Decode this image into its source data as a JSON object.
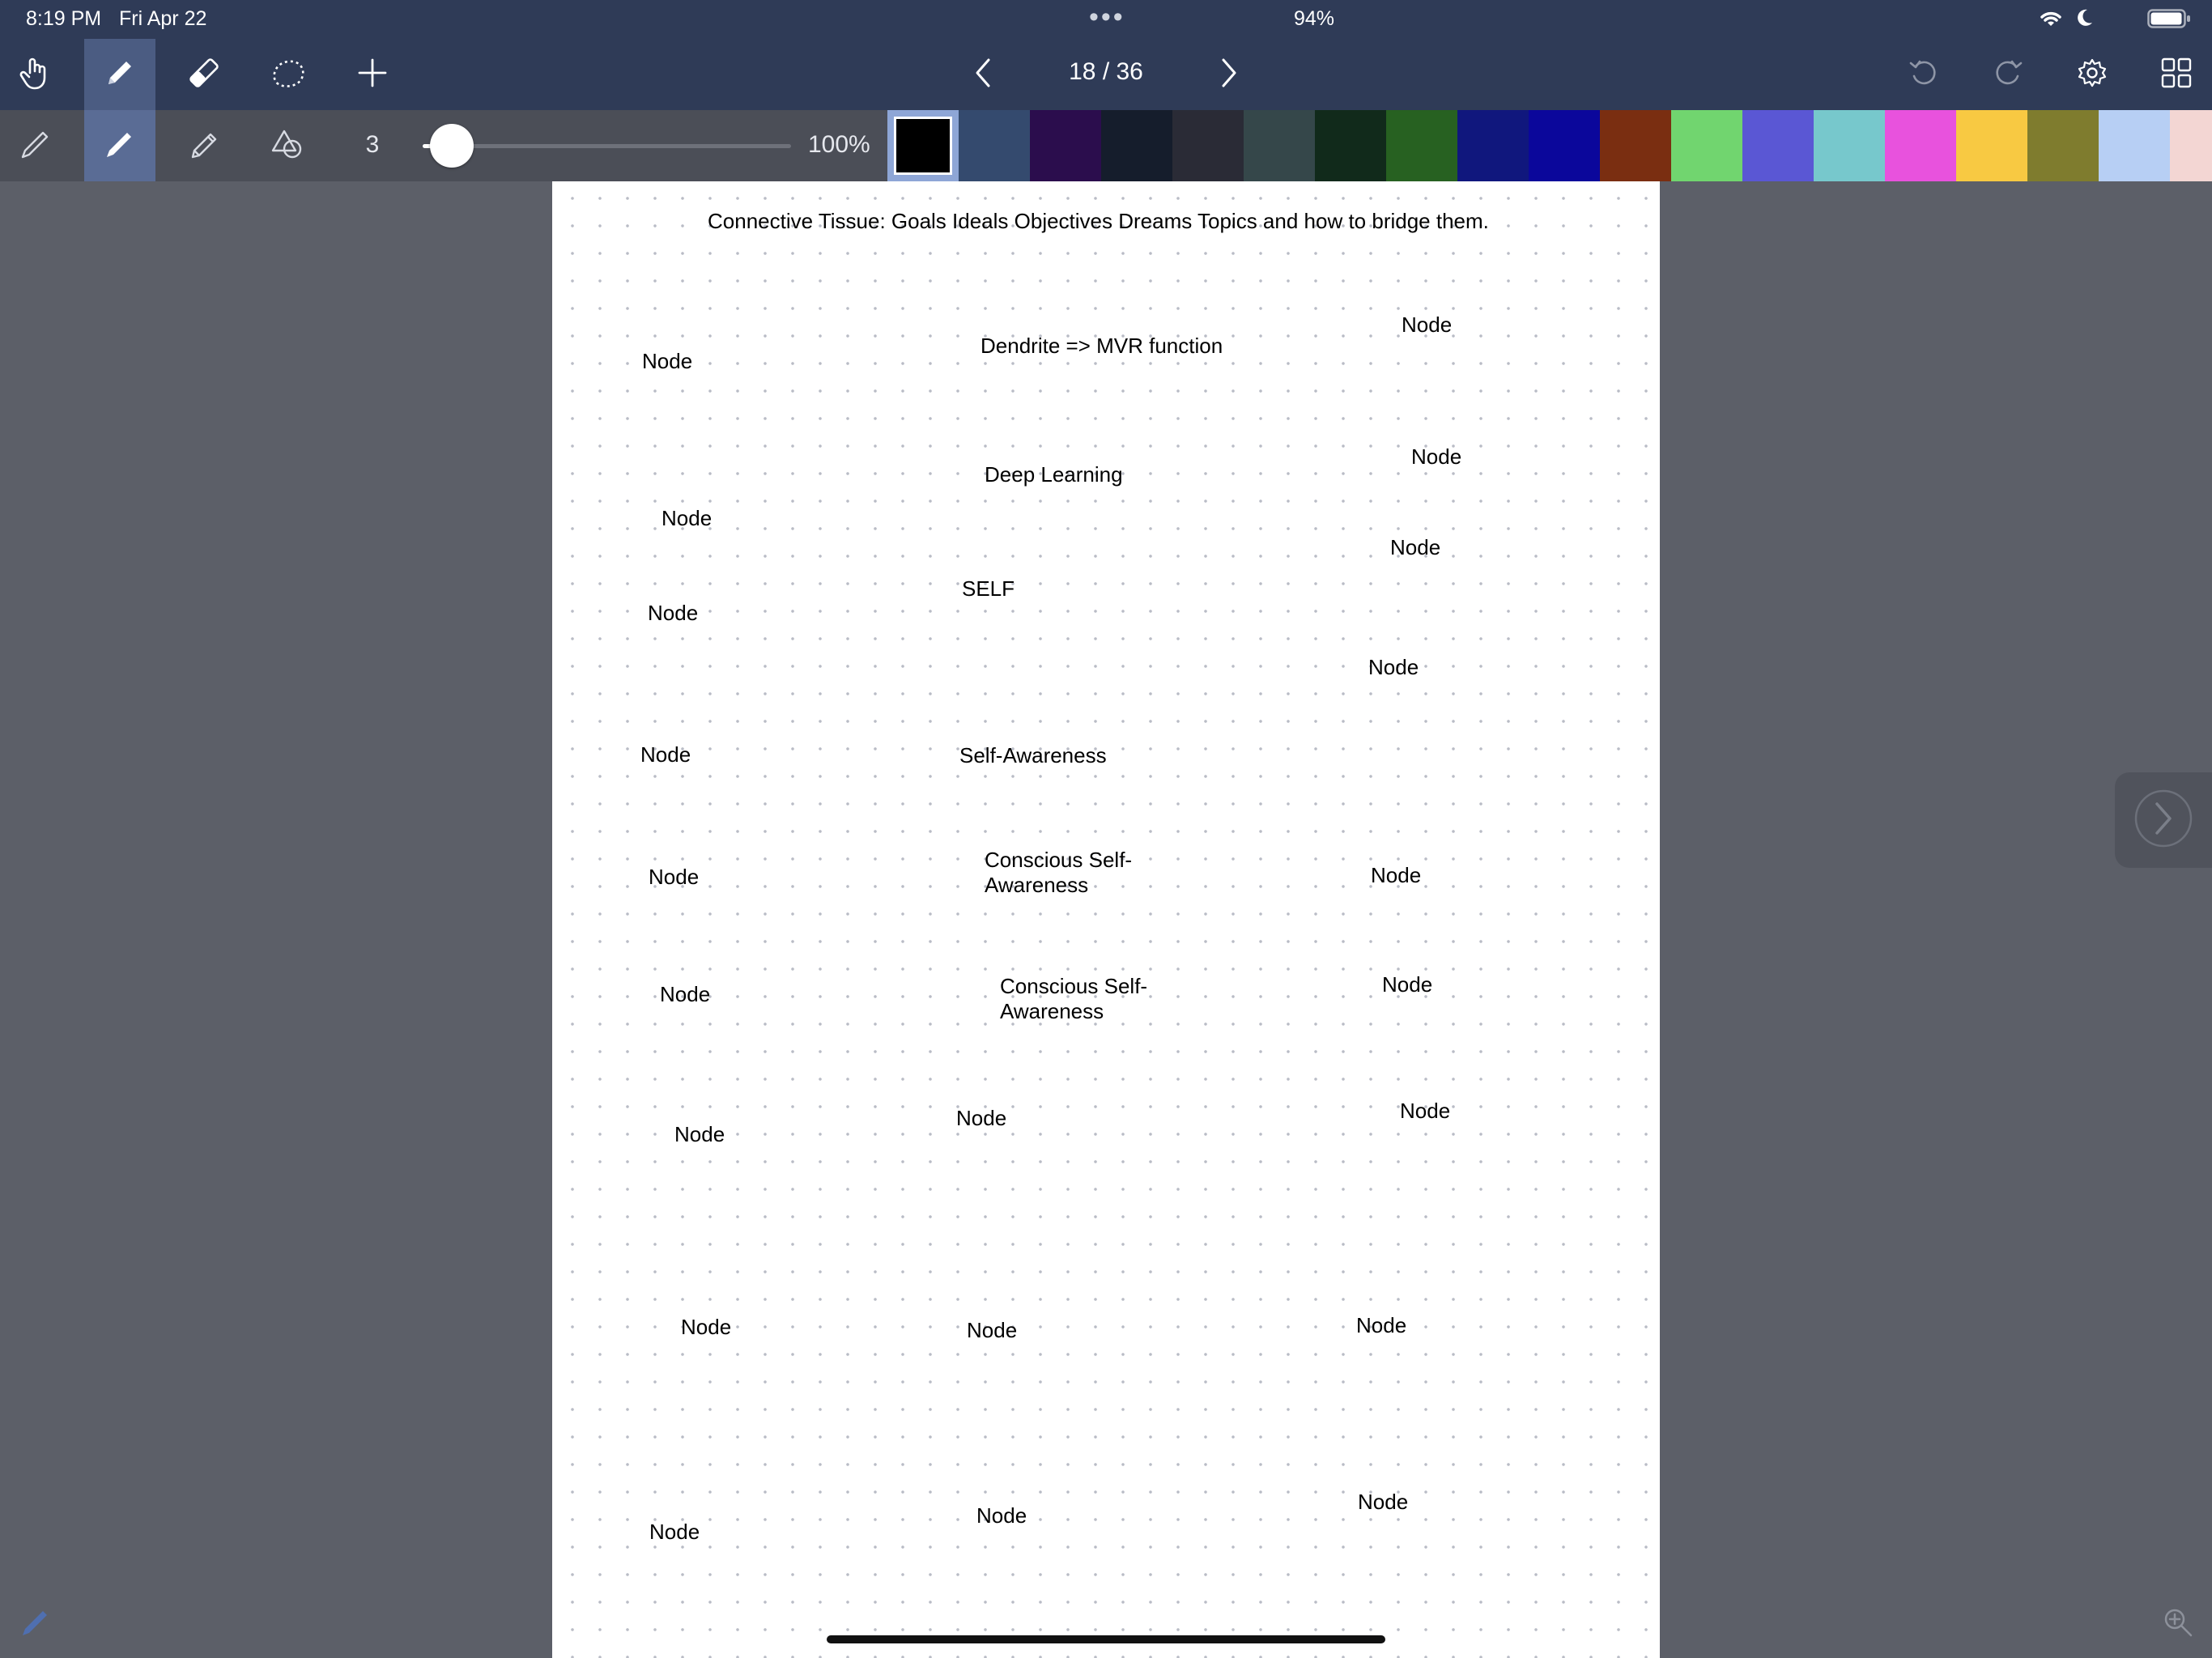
{
  "status_bar": {
    "time": "8:19 PM",
    "date": "Fri Apr 22",
    "multitask_dots": "•••",
    "battery_percent": "94%",
    "icons": [
      "wifi-icon",
      "moon-icon",
      "battery-icon"
    ]
  },
  "nav": {
    "page_indicator": "18 / 36",
    "tools": [
      "hand-icon",
      "pen-icon",
      "eraser-icon",
      "lasso-icon",
      "plus-icon"
    ],
    "right_tools": [
      "undo-icon",
      "redo-icon",
      "gear-icon",
      "grid-icon"
    ],
    "prev": "chevron-left-icon",
    "next": "chevron-right-icon"
  },
  "toolbar2": {
    "tools": [
      "fountain-pen-icon",
      "ballpoint-pen-icon",
      "highlighter-icon",
      "shapes-icon"
    ],
    "stroke_width": "3",
    "opacity_label": "100%",
    "slider_fraction": 0.08,
    "swatches": [
      "#000000",
      "#344a6e",
      "#2b0d4d",
      "#151d2c",
      "#2a2b36",
      "#35474a",
      "#112a1b",
      "#276121",
      "#10177d",
      "#0b079b",
      "#7a2e11",
      "#71d56f",
      "#5a57d4",
      "#77c8cc",
      "#e852dd",
      "#f8c942",
      "#7f7c2e",
      "#b7cff4",
      "#f3d6d3"
    ],
    "selected_swatch": "#000000"
  },
  "page": {
    "title": "Connective Tissue: Goals Ideals Objectives Dreams Topics and how to bridge them.",
    "center_labels": {
      "dendrite": "Dendrite => MVR function",
      "deep_learning": "Deep Learning",
      "self": "SELF",
      "self_awareness": "Self-Awareness",
      "conscious_1": "Conscious Self-\nAwareness",
      "conscious_2": "Conscious Self-\nAwareness"
    },
    "node_label": "Node"
  },
  "side": {
    "next_page": "chevron-right-icon",
    "pencil_corner": "pencil-icon",
    "zoom": "zoom-in-icon"
  }
}
